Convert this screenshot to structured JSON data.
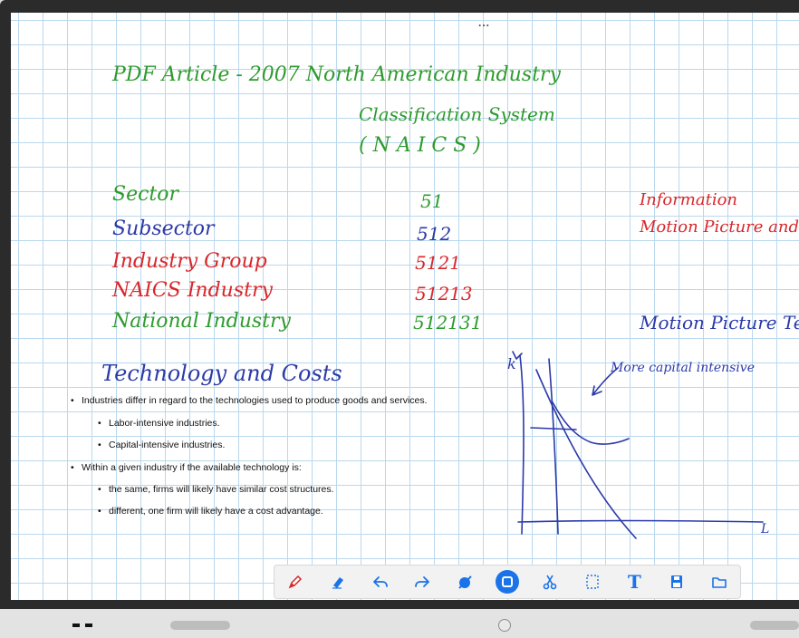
{
  "header": {
    "title_line1": "PDF Article  -  2007   North American Industry",
    "title_line2": "Classification System",
    "title_line3": "( N A I C S )"
  },
  "hierarchy": {
    "rows": [
      {
        "label": "Sector",
        "code": "51",
        "color": "#2e9b2e"
      },
      {
        "label": "Subsector",
        "code": "512",
        "color": "#2b3aa8"
      },
      {
        "label": "Industry Group",
        "code": "5121",
        "color": "#d8272b"
      },
      {
        "label": "NAICS  Industry",
        "code": "51213",
        "color": "#d8272b"
      },
      {
        "label": "National  Industry",
        "code": "512131",
        "color": "#2e9b2e"
      }
    ],
    "right_notes": [
      "Information",
      "Motion Picture and",
      "Motion Picture Te"
    ]
  },
  "section": {
    "heading": "Technology  and  Costs",
    "graph_note": "More capital intensive",
    "graph_y_label": "k",
    "graph_x_label": "L"
  },
  "bullets": [
    {
      "text": "Industries differ in regard to the technologies used to produce goods and services.",
      "level": 1
    },
    {
      "text": "Labor-intensive industries.",
      "level": 2
    },
    {
      "text": "Capital-intensive industries.",
      "level": 2
    },
    {
      "text": "Within a given industry if the available technology is:",
      "level": 1
    },
    {
      "text": "the same, firms will likely have similar cost structures.",
      "level": 2
    },
    {
      "text": "different, one firm will likely have a cost advantage.",
      "level": 2
    }
  ],
  "toolbar": {
    "tools": [
      "pen-icon",
      "eraser-icon",
      "undo-icon",
      "redo-icon",
      "clear-icon",
      "select-icon",
      "cut-icon",
      "marquee-icon",
      "text-icon",
      "save-icon",
      "folder-icon"
    ],
    "active_tool": "select-icon",
    "accent": "#1a73e8",
    "pen_color": "#d8272b",
    "T_label": "T"
  },
  "window_menu": "..."
}
